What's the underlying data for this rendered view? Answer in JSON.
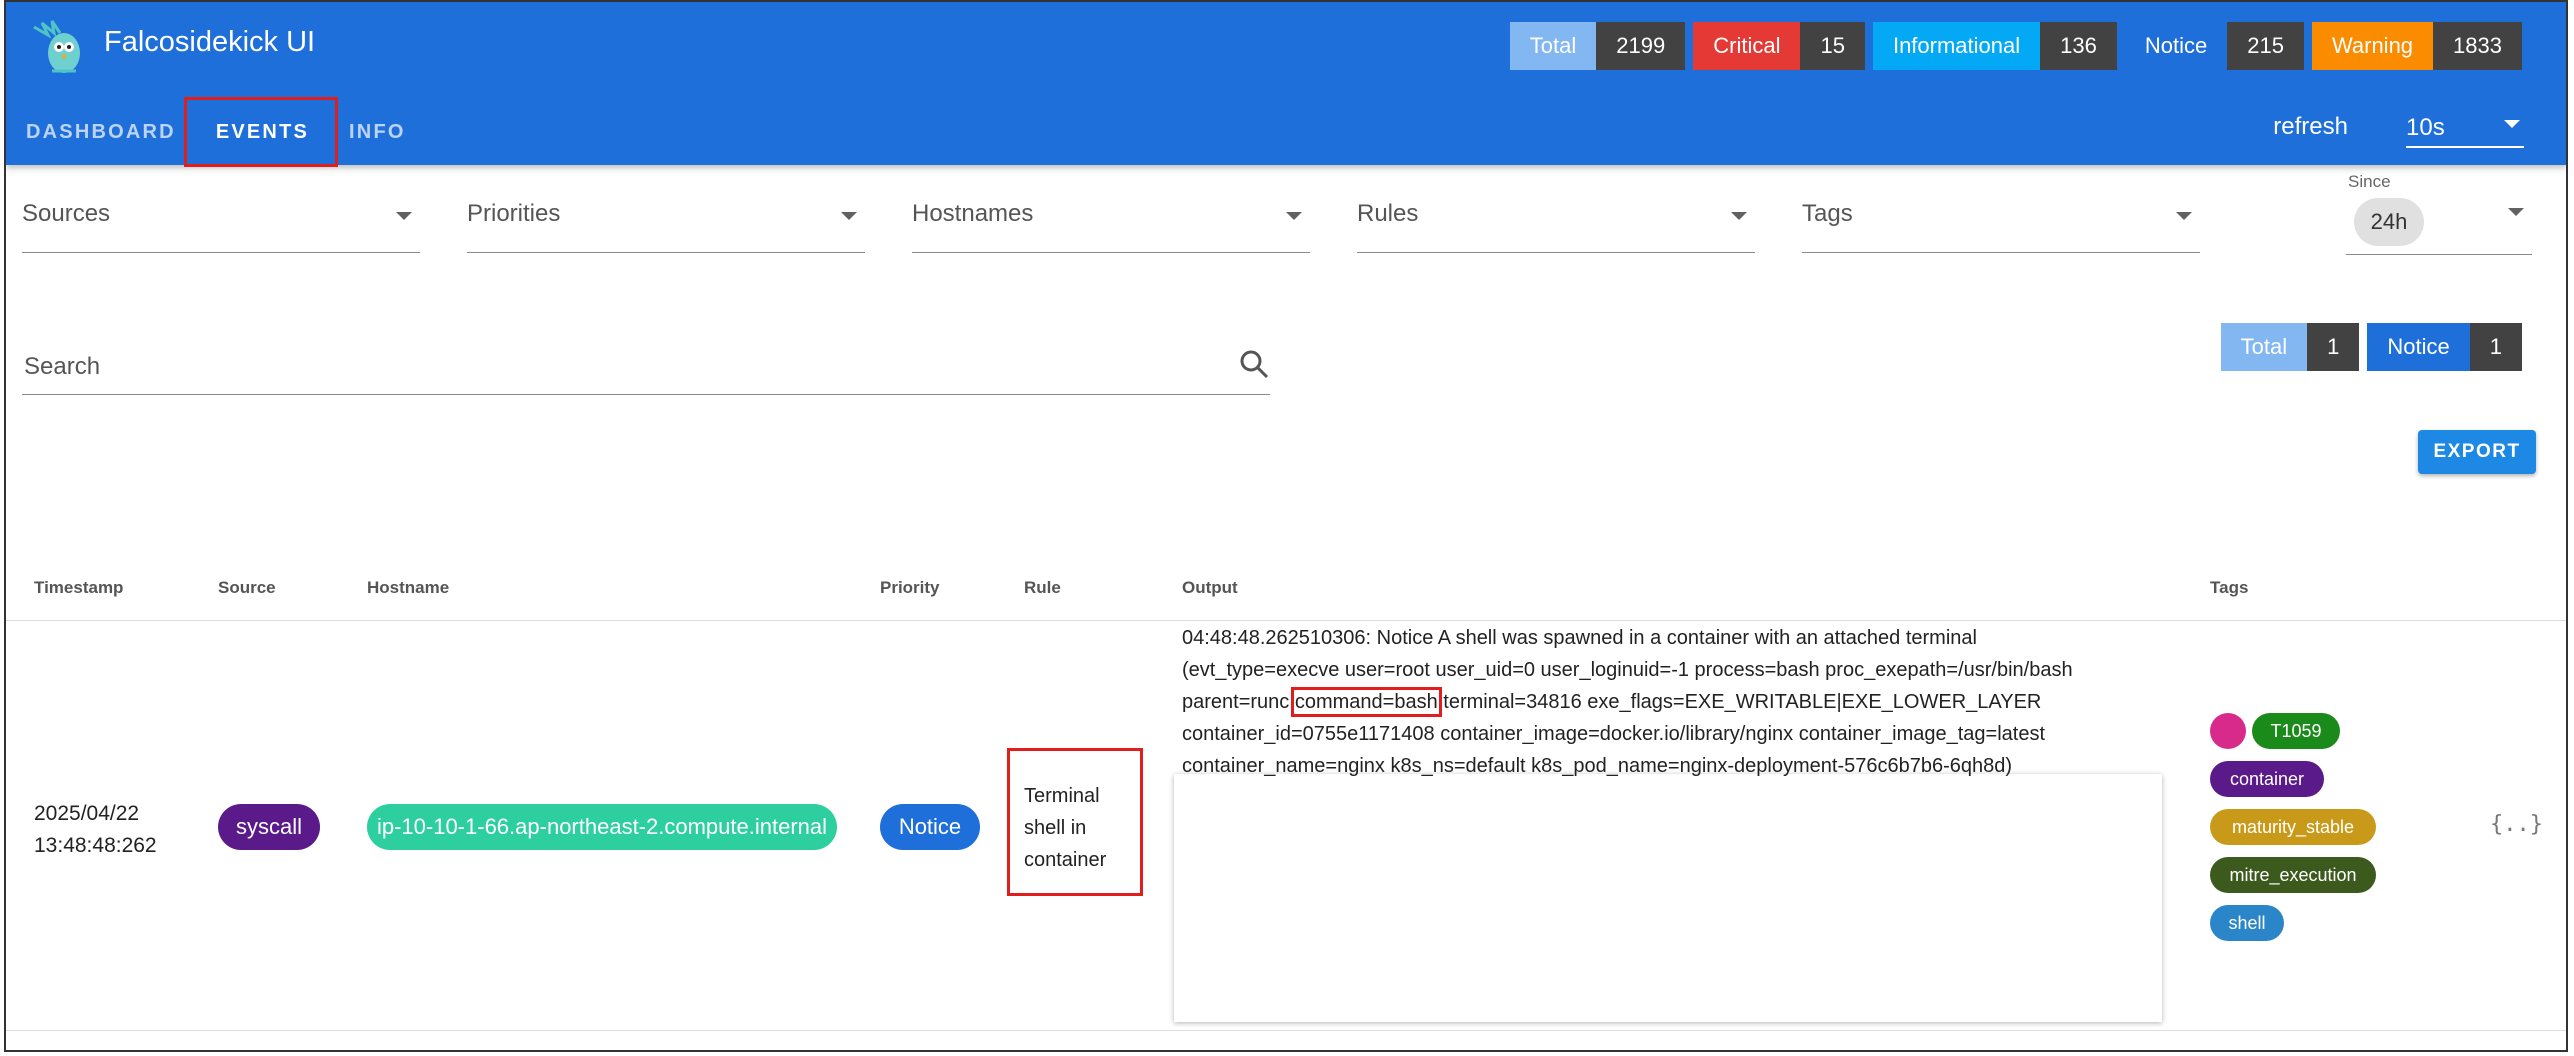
{
  "app": {
    "title": "Falcosidekick UI"
  },
  "header_counters": [
    {
      "label": "Total",
      "value": "2199",
      "color": "#82b7f2",
      "text": "#ffffff"
    },
    {
      "label": "Critical",
      "value": "15",
      "color": "#e53935",
      "text": "#ffffff"
    },
    {
      "label": "Informational",
      "value": "136",
      "color": "#03a9f4",
      "text": "#ffffff"
    },
    {
      "label": "Notice",
      "value": "215",
      "color": "#1e6fd9",
      "text": "#ffffff"
    },
    {
      "label": "Warning",
      "value": "1833",
      "color": "#fb8c00",
      "text": "#ffffff"
    }
  ],
  "nav": {
    "tabs": [
      "DASHBOARD",
      "EVENTS",
      "INFO"
    ],
    "active": "EVENTS"
  },
  "refresh": {
    "label": "refresh",
    "value": "10s"
  },
  "filters": {
    "sources": "Sources",
    "priorities": "Priorities",
    "hostnames": "Hostnames",
    "rules": "Rules",
    "tags": "Tags",
    "since_label": "Since",
    "since_value": "24h"
  },
  "search": {
    "placeholder": "Search"
  },
  "summary_counters": [
    {
      "label": "Total",
      "value": "1",
      "color": "#82b7f2"
    },
    {
      "label": "Notice",
      "value": "1",
      "color": "#1e6fd9"
    }
  ],
  "export_label": "EXPORT",
  "table": {
    "headers": [
      "Timestamp",
      "Source",
      "Hostname",
      "Priority",
      "Rule",
      "Output",
      "Tags"
    ],
    "row": {
      "date": "2025/04/22",
      "time": "13:48:48:262",
      "source": "syscall",
      "hostname": "ip-10-10-1-66.ap-northeast-2.compute.internal",
      "priority": "Notice",
      "rule_lines": [
        "Terminal",
        "shell in",
        "container"
      ],
      "output": {
        "line1": "04:48:48.262510306: Notice A shell was spawned in a container with an attached terminal",
        "line2": "(evt_type=execve user=root user_uid=0 user_loginuid=-1 process=bash proc_exepath=/usr/bin/bash",
        "line3_pre": "parent=runc ",
        "line3_highlight": "command=bash",
        "line3_post": " terminal=34816 exe_flags=EXE_WRITABLE|EXE_LOWER_LAYER",
        "line4": "container_id=0755e1171408 container_image=docker.io/library/nginx container_image_tag=latest",
        "line5": "container_name=nginx k8s_ns=default k8s_pod_name=nginx-deployment-576c6b7b6-6qh8d)"
      },
      "tags": [
        {
          "label": "T1059",
          "color": "#1a8a1a"
        },
        {
          "label": "container",
          "color": "#5b1a8a"
        },
        {
          "label": "maturity_stable",
          "color": "#c99a1a"
        },
        {
          "label": "mitre_execution",
          "color": "#3d5a1e"
        },
        {
          "label": "shell",
          "color": "#2a86c8"
        }
      ],
      "tag_dot_color": "#d82a8a",
      "json_icon": "{..}"
    }
  },
  "colors": {
    "appbar": "#1e6fd9",
    "source_chip": "#5b1a8a",
    "hostname_chip": "#2ecf9f",
    "priority_chip": "#1e6fd9",
    "annotation": "#e01e1e"
  }
}
